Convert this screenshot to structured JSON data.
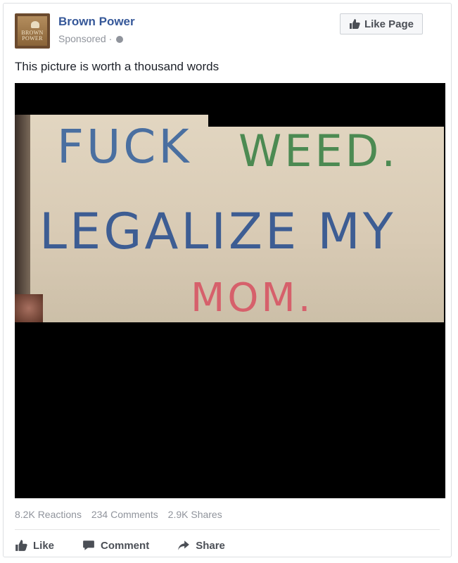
{
  "post": {
    "page_name": "Brown Power",
    "sponsored_label": "Sponsored · ",
    "avatar_text_line1": "BROWN",
    "avatar_text_line2": "POWER",
    "like_page_label": "Like Page",
    "caption": "This picture is worth a thousand words"
  },
  "image": {
    "sign_line_1a": "FUCK",
    "sign_line_1b": "WEED.",
    "sign_line_2": "LEGALIZE MY",
    "sign_line_3": "MOM."
  },
  "stats": {
    "reactions": "8.2K Reactions",
    "comments": "234 Comments",
    "shares": "2.9K Shares"
  },
  "actions": {
    "like": "Like",
    "comment": "Comment",
    "share": "Share"
  },
  "icons": {
    "avatar": "page-logo",
    "globe": "globe-icon",
    "like": "thumbs-up-icon",
    "comment": "comment-icon",
    "share": "share-arrow-icon"
  }
}
